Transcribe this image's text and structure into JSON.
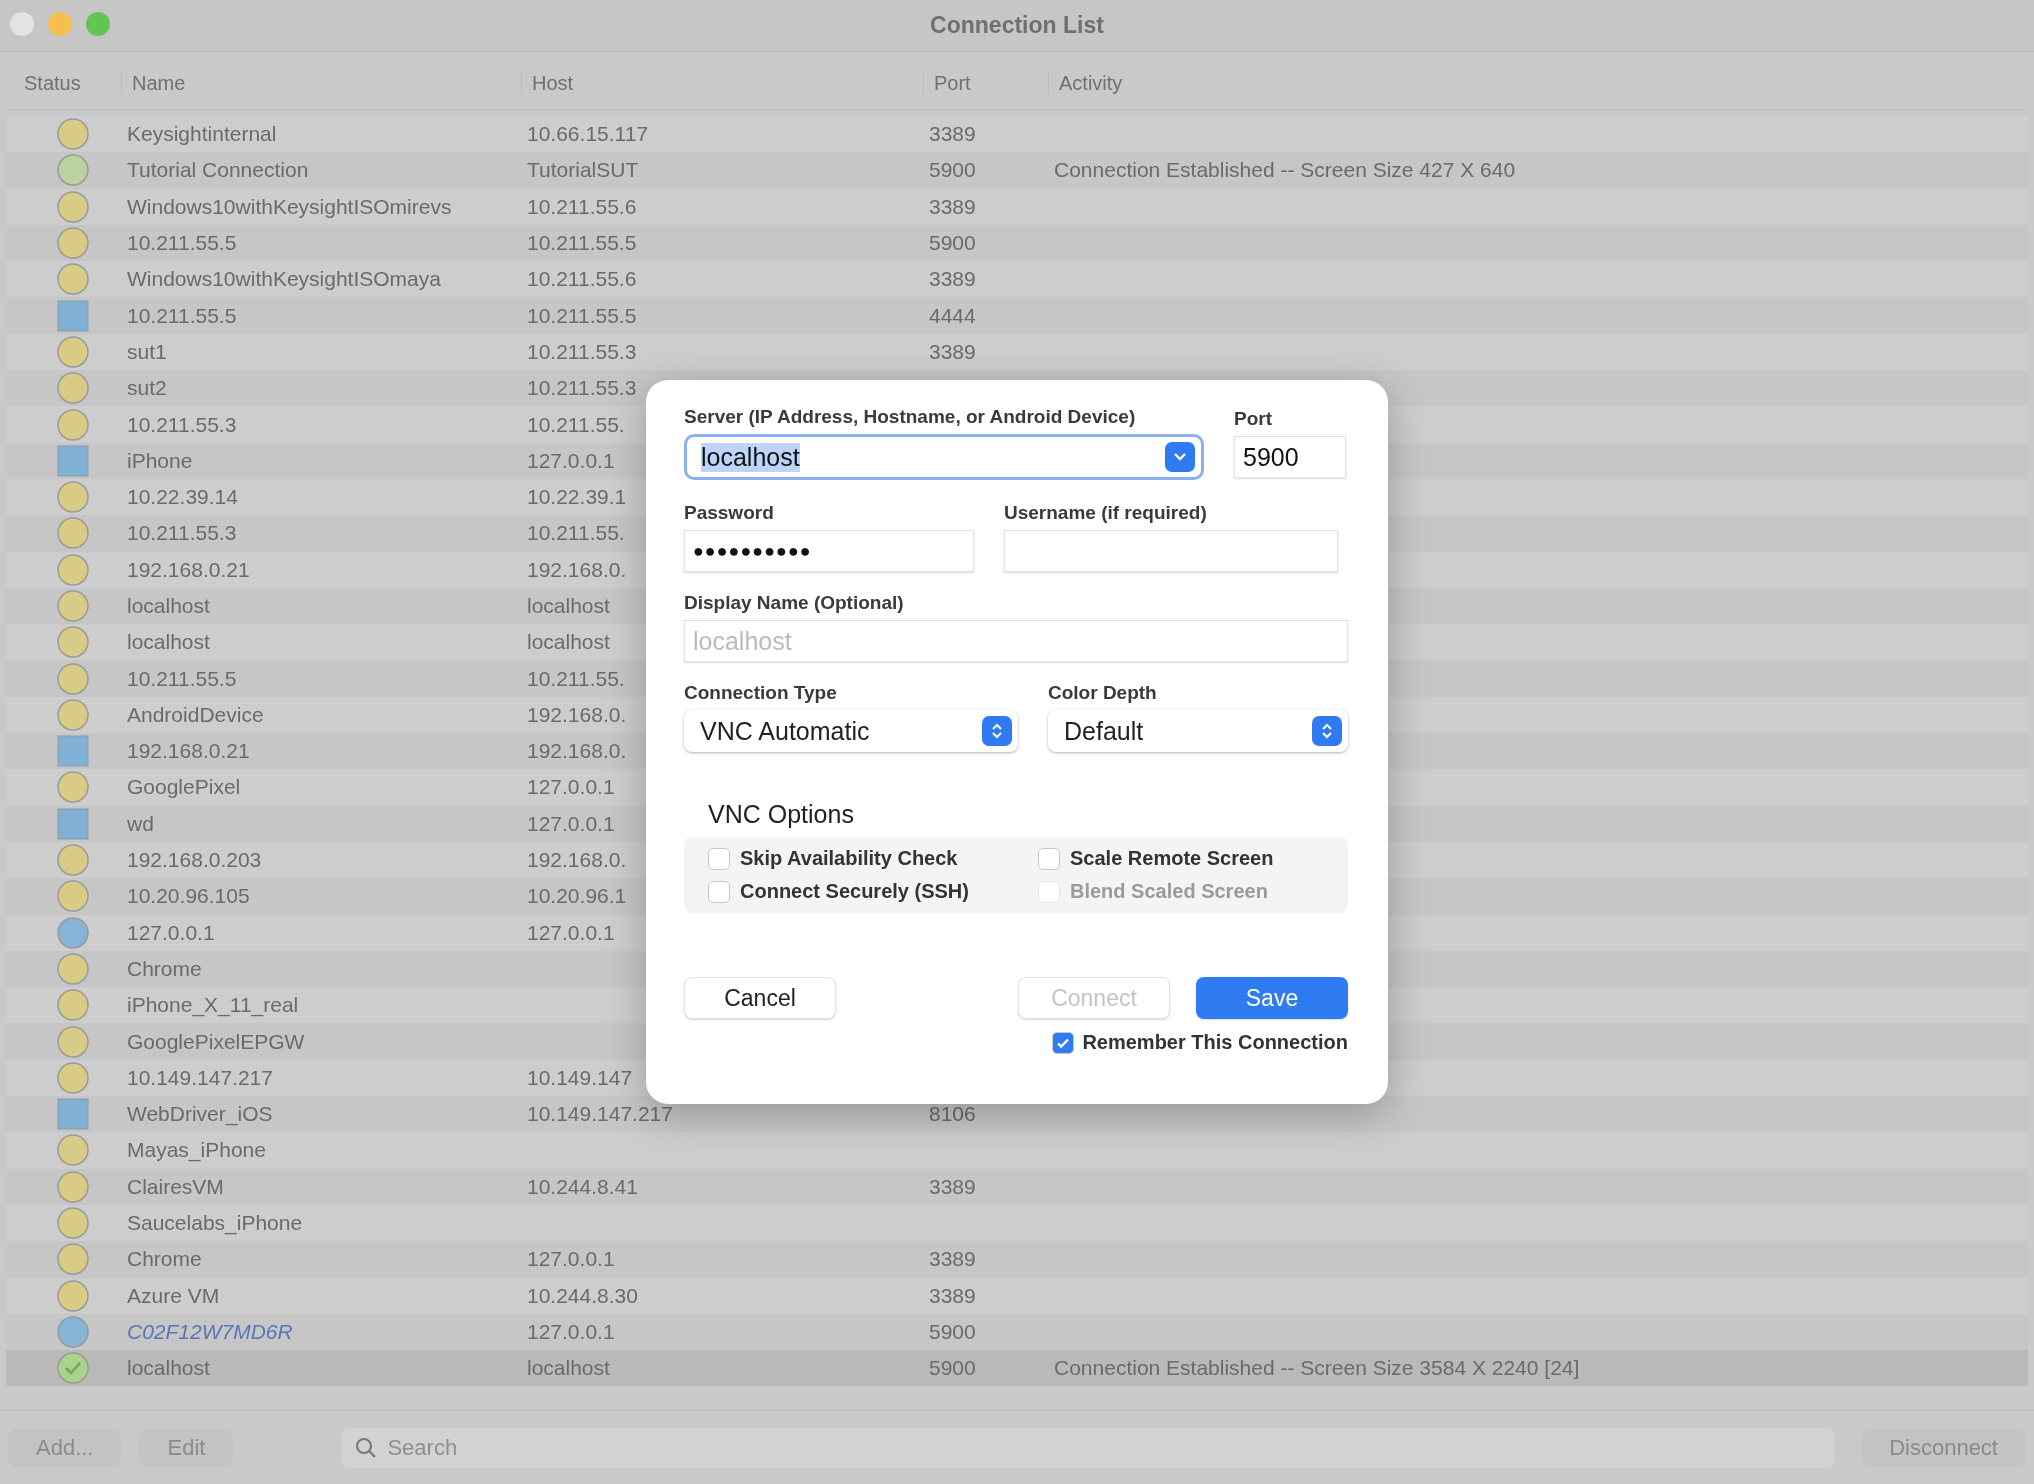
{
  "window": {
    "title": "Connection List"
  },
  "table": {
    "columns": [
      "Status",
      "Name",
      "Host",
      "Port",
      "Activity"
    ],
    "rows": [
      {
        "kind": "circle",
        "color": "#d8cb86",
        "name": "Keysightinternal",
        "host": "10.66.15.117",
        "port": "3389",
        "linked": false,
        "selected": false
      },
      {
        "kind": "circle",
        "color": "#bcd1a0",
        "name": "Tutorial Connection",
        "host": "TutorialSUT",
        "port": "5900",
        "activity": "Connection Established -- Screen Size 427 X 640",
        "linked": false,
        "selected": false
      },
      {
        "kind": "circle",
        "color": "#d8cb86",
        "name": "Windows10withKeysightISOmirevs",
        "host": "10.211.55.6",
        "port": "3389",
        "linked": false,
        "selected": false
      },
      {
        "kind": "circle",
        "color": "#d8cb86",
        "name": "10.211.55.5",
        "host": "10.211.55.5",
        "port": "5900",
        "linked": false,
        "selected": false
      },
      {
        "kind": "circle",
        "color": "#d8cb86",
        "name": "Windows10withKeysightISOmaya",
        "host": "10.211.55.6",
        "port": "3389",
        "linked": false,
        "selected": false
      },
      {
        "kind": "square",
        "color": "#80b1d4",
        "name": "10.211.55.5",
        "host": "10.211.55.5",
        "port": "4444",
        "linked": false,
        "selected": false
      },
      {
        "kind": "circle",
        "color": "#d8cb86",
        "name": "sut1",
        "host": "10.211.55.3",
        "port": "3389",
        "linked": false,
        "selected": false
      },
      {
        "kind": "circle",
        "color": "#d8cb86",
        "name": "sut2",
        "host": "10.211.55.3",
        "linked": false,
        "selected": false
      },
      {
        "kind": "circle",
        "color": "#d8cb86",
        "name": "10.211.55.3",
        "host": "10.211.55.",
        "linked": false,
        "selected": false
      },
      {
        "kind": "square",
        "color": "#80b1d4",
        "name": "iPhone",
        "host": "127.0.0.1",
        "linked": false,
        "selected": false
      },
      {
        "kind": "circle",
        "color": "#d8cb86",
        "name": "10.22.39.14",
        "host": "10.22.39.1",
        "linked": false,
        "selected": false
      },
      {
        "kind": "circle",
        "color": "#d8cb86",
        "name": "10.211.55.3",
        "host": "10.211.55.",
        "linked": false,
        "selected": false
      },
      {
        "kind": "circle",
        "color": "#d8cb86",
        "name": "192.168.0.21",
        "host": "192.168.0.",
        "linked": false,
        "selected": false
      },
      {
        "kind": "circle",
        "color": "#d8cb86",
        "name": "localhost",
        "host": "localhost",
        "linked": false,
        "selected": false
      },
      {
        "kind": "circle",
        "color": "#d8cb86",
        "name": "localhost",
        "host": "localhost",
        "linked": false,
        "selected": false
      },
      {
        "kind": "circle",
        "color": "#d8cb86",
        "name": "10.211.55.5",
        "host": "10.211.55.",
        "linked": false,
        "selected": false
      },
      {
        "kind": "circle",
        "color": "#d8cb86",
        "name": "AndroidDevice",
        "host": "192.168.0.",
        "linked": false,
        "selected": false
      },
      {
        "kind": "square",
        "color": "#80b1d4",
        "name": "192.168.0.21",
        "host": "192.168.0.",
        "linked": false,
        "selected": false
      },
      {
        "kind": "circle",
        "color": "#d8cb86",
        "name": "GooglePixel",
        "host": "127.0.0.1",
        "linked": false,
        "selected": false
      },
      {
        "kind": "square",
        "color": "#80b1d4",
        "name": "wd",
        "host": "127.0.0.1",
        "linked": false,
        "selected": false
      },
      {
        "kind": "circle",
        "color": "#d8cb86",
        "name": "192.168.0.203",
        "host": "192.168.0.",
        "linked": false,
        "selected": false
      },
      {
        "kind": "circle",
        "color": "#d8cb86",
        "name": "10.20.96.105",
        "host": "10.20.96.1",
        "linked": false,
        "selected": false
      },
      {
        "kind": "circle",
        "color": "#86b4d6",
        "name": "127.0.0.1",
        "host": "127.0.0.1",
        "linked": false,
        "selected": false
      },
      {
        "kind": "circle",
        "color": "#d8cb86",
        "name": "Chrome",
        "linked": false,
        "selected": false
      },
      {
        "kind": "circle",
        "color": "#d8cb86",
        "name": "iPhone_X_11_real",
        "linked": false,
        "selected": false
      },
      {
        "kind": "circle",
        "color": "#d8cb86",
        "name": "GooglePixelEPGW",
        "linked": false,
        "selected": false
      },
      {
        "kind": "circle",
        "color": "#d8cb86",
        "name": "10.149.147.217",
        "host": "10.149.147",
        "linked": false,
        "selected": false
      },
      {
        "kind": "square",
        "color": "#80b1d4",
        "name": "WebDriver_iOS",
        "host": "10.149.147.217",
        "port": "8106",
        "linked": false,
        "selected": false
      },
      {
        "kind": "circle",
        "color": "#d8cb86",
        "name": "Mayas_iPhone",
        "linked": false,
        "selected": false
      },
      {
        "kind": "circle",
        "color": "#d8cb86",
        "name": "ClairesVM",
        "host": "10.244.8.41",
        "port": "3389",
        "linked": false,
        "selected": false
      },
      {
        "kind": "circle",
        "color": "#d8cb86",
        "name": "Saucelabs_iPhone",
        "linked": false,
        "selected": false
      },
      {
        "kind": "circle",
        "color": "#d8cb86",
        "name": "Chrome",
        "host": "127.0.0.1",
        "port": "3389",
        "linked": false,
        "selected": false
      },
      {
        "kind": "circle",
        "color": "#d8cb86",
        "name": "Azure VM",
        "host": "10.244.8.30",
        "port": "3389",
        "linked": false,
        "selected": false
      },
      {
        "kind": "circle",
        "color": "#86b4d6",
        "name": "C02F12W7MD6R",
        "host": "127.0.0.1",
        "port": "5900",
        "linked": true,
        "selected": false
      },
      {
        "kind": "check",
        "color": "#a9d38a",
        "name": "localhost",
        "host": "localhost",
        "port": "5900",
        "activity": "Connection Established -- Screen Size 3584 X 2240 [24]",
        "linked": false,
        "selected": true
      }
    ]
  },
  "bottom_bar": {
    "buttons": [
      {
        "label": "Add..."
      },
      {
        "label": "Edit"
      }
    ],
    "search": {
      "placeholder": "Search"
    },
    "disconnect": {
      "label": "Disconnect"
    }
  },
  "dialog": {
    "server": {
      "label": "Server (IP Address, Hostname, or Android Device)",
      "value": "localhost"
    },
    "port": {
      "label": "Port",
      "value": "5900"
    },
    "password": {
      "label": "Password",
      "value": "●●●●●●●●●●"
    },
    "username": {
      "label": "Username (if required)"
    },
    "display_name": {
      "label": "Display Name (Optional)",
      "placeholder": "localhost"
    },
    "connection_type": {
      "label": "Connection Type",
      "value": "VNC Automatic"
    },
    "color_depth": {
      "label": "Color Depth",
      "value": "Default"
    },
    "options": {
      "title": "VNC Options",
      "items": [
        {
          "label": "Skip Availability Check",
          "checked": false,
          "disabled": false
        },
        {
          "label": "Scale Remote Screen",
          "checked": false,
          "disabled": false
        },
        {
          "label": "Connect Securely (SSH)",
          "checked": false,
          "disabled": false
        },
        {
          "label": "Blend Scaled Screen",
          "checked": false,
          "disabled": true
        }
      ]
    },
    "buttons": [
      {
        "label": "Cancel",
        "kind": "normal"
      },
      {
        "label": "Connect",
        "kind": "disabled"
      },
      {
        "label": "Save",
        "kind": "primary"
      }
    ],
    "remember": {
      "label": "Remember This Connection",
      "checked": true
    }
  }
}
